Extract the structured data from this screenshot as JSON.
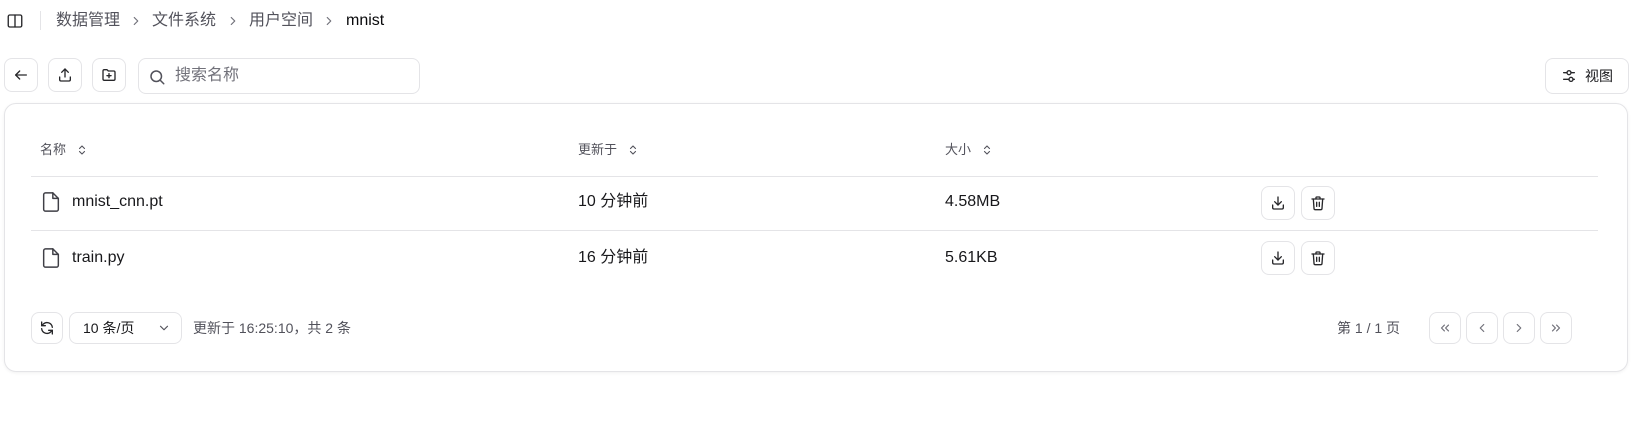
{
  "breadcrumb": {
    "items": [
      "数据管理",
      "文件系统",
      "用户空间"
    ],
    "current": "mnist"
  },
  "toolbar": {
    "search_placeholder": "搜索名称",
    "view_label": "视图",
    "icons": [
      "arrow-left-icon",
      "upload-icon",
      "folder-plus-icon",
      "search-icon",
      "sliders-icon"
    ]
  },
  "table": {
    "columns": [
      "名称",
      "更新于",
      "大小"
    ],
    "rows": [
      {
        "name": "mnist_cnn.pt",
        "updated": "10 分钟前",
        "size": "4.58MB"
      },
      {
        "name": "train.py",
        "updated": "16 分钟前",
        "size": "5.61KB"
      }
    ],
    "row_actions": [
      "download-icon",
      "trash-icon"
    ]
  },
  "footer": {
    "page_size": "10 条/页",
    "status": "更新于 16:25:10，共 2 条",
    "page_info": "第 1 / 1 页"
  },
  "colors": {
    "border": "#e4e4e7",
    "text": "#18181b",
    "muted": "#52525b",
    "icon": "#27272a"
  }
}
